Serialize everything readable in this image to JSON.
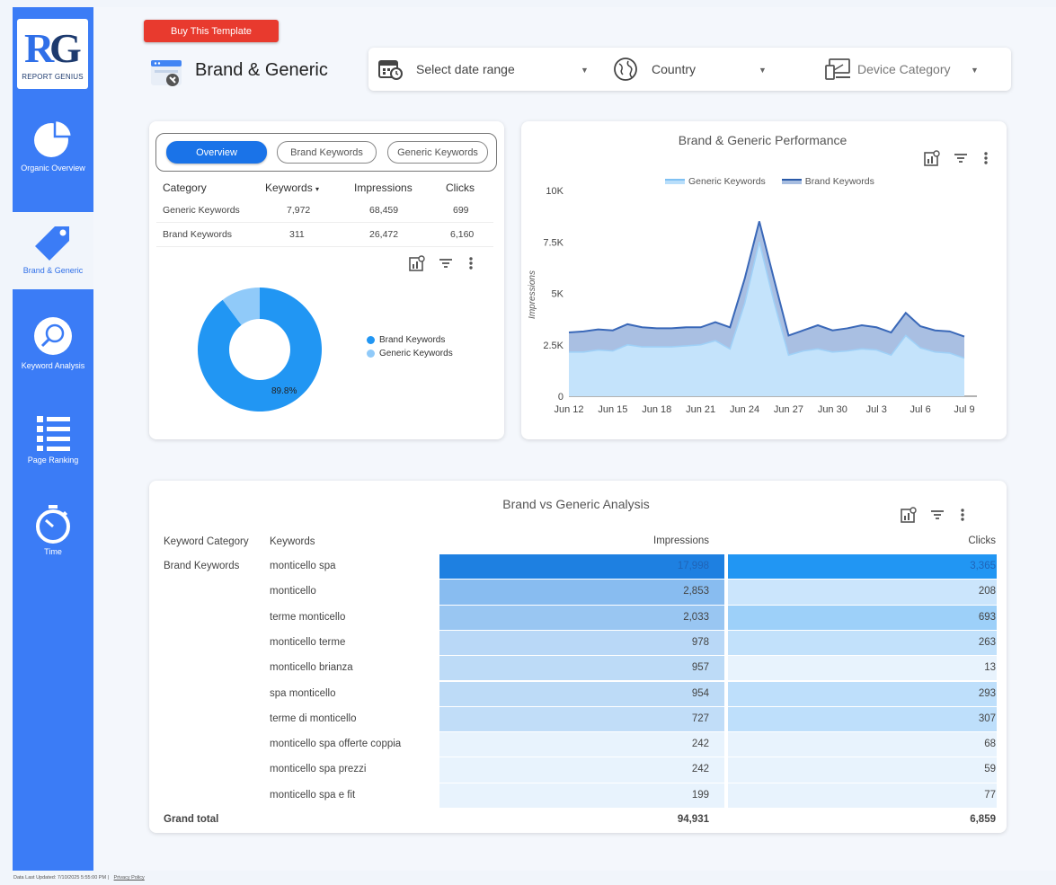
{
  "sidebar": {
    "logo_text": "REPORT GENIUS",
    "logo_letters": "RG",
    "items": [
      {
        "label": "Organic Overview",
        "icon": "pie-chart-icon"
      },
      {
        "label": "Brand & Generic",
        "icon": "tag-icon"
      },
      {
        "label": "Keyword Analysis",
        "icon": "magnify-icon"
      },
      {
        "label": "Page Ranking",
        "icon": "list-icon"
      },
      {
        "label": "Time",
        "icon": "stopwatch-icon"
      }
    ]
  },
  "header": {
    "buy_label": "Buy This Template",
    "title": "Brand & Generic"
  },
  "filters": {
    "date": "Select date range",
    "country": "Country",
    "device": "Device Category"
  },
  "tabs": [
    "Overview",
    "Brand Keywords",
    "Generic Keywords"
  ],
  "summary_table": {
    "headers": [
      "Category",
      "Keywords",
      "Impressions",
      "Clicks"
    ],
    "sort_indicator": "▾",
    "rows": [
      [
        "Generic Keywords",
        "7,972",
        "68,459",
        "699"
      ],
      [
        "Brand Keywords",
        "311",
        "26,472",
        "6,160"
      ]
    ]
  },
  "donut": {
    "legend": [
      "Brand Keywords",
      "Generic Keywords"
    ],
    "label": "89.8%",
    "values": [
      89.8,
      10.2
    ],
    "colors": [
      "#2196f3",
      "#90caf9"
    ]
  },
  "chart_data": {
    "type": "area",
    "title": "Brand & Generic Performance",
    "ylabel": "Impressions",
    "xlabel": "",
    "x_ticks": [
      "Jun 12",
      "Jun 15",
      "Jun 18",
      "Jun 21",
      "Jun 24",
      "Jun 27",
      "Jun 30",
      "Jul 3",
      "Jul 6",
      "Jul 9"
    ],
    "y_ticks": [
      "0",
      "2.5K",
      "5K",
      "7.5K",
      "10K"
    ],
    "ylim": [
      0,
      10000
    ],
    "legend_position": "top",
    "x": [
      "Jun 12",
      "Jun 13",
      "Jun 14",
      "Jun 15",
      "Jun 16",
      "Jun 17",
      "Jun 18",
      "Jun 19",
      "Jun 20",
      "Jun 21",
      "Jun 22",
      "Jun 23",
      "Jun 24",
      "Jun 25",
      "Jun 26",
      "Jun 27",
      "Jun 28",
      "Jun 29",
      "Jun 30",
      "Jul 1",
      "Jul 2",
      "Jul 3",
      "Jul 4",
      "Jul 5",
      "Jul 6",
      "Jul 7"
    ],
    "series": [
      {
        "name": "Generic Keywords",
        "color": "#9fd0f7",
        "values": [
          2150,
          2150,
          2250,
          2200,
          2500,
          2400,
          2400,
          2400,
          2450,
          2500,
          2700,
          2300,
          4500,
          7500,
          4600,
          2000,
          2200,
          2300,
          2150,
          2200,
          2300,
          2250,
          2000,
          2950,
          2350,
          2150,
          2100,
          1850
        ]
      },
      {
        "name": "Brand Keywords",
        "color": "#3a68b8",
        "values": [
          3100,
          3150,
          3250,
          3200,
          3500,
          3350,
          3300,
          3300,
          3350,
          3350,
          3600,
          3350,
          5700,
          8500,
          5700,
          2950,
          3200,
          3450,
          3200,
          3300,
          3450,
          3350,
          3100,
          4050,
          3400,
          3200,
          3150,
          2900
        ]
      }
    ]
  },
  "analysis": {
    "title": "Brand vs Generic Analysis",
    "headers": [
      "Keyword Category",
      "Keywords",
      "Impressions",
      "Clicks"
    ],
    "category": "Brand Keywords",
    "rows": [
      {
        "keyword": "monticello spa",
        "impressions": "17,998",
        "clicks": "3,365",
        "imp_level": 1.0,
        "clk_level": 1.0
      },
      {
        "keyword": "monticello",
        "impressions": "2,853",
        "clicks": "208",
        "imp_level": 0.26,
        "clk_level": 0.03
      },
      {
        "keyword": "terme monticello",
        "impressions": "2,033",
        "clicks": "693",
        "imp_level": 0.18,
        "clk_level": 0.17
      },
      {
        "keyword": "monticello terme",
        "impressions": "978",
        "clicks": "263",
        "imp_level": 0.07,
        "clk_level": 0.05
      },
      {
        "keyword": "monticello brianza",
        "impressions": "957",
        "clicks": "13",
        "imp_level": 0.06,
        "clk_level": 0.0
      },
      {
        "keyword": "spa monticello",
        "impressions": "954",
        "clicks": "293",
        "imp_level": 0.06,
        "clk_level": 0.06
      },
      {
        "keyword": "terme di monticello",
        "impressions": "727",
        "clicks": "307",
        "imp_level": 0.05,
        "clk_level": 0.06
      },
      {
        "keyword": "monticello spa offerte coppia",
        "impressions": "242",
        "clicks": "68",
        "imp_level": 0.01,
        "clk_level": 0.01
      },
      {
        "keyword": "monticello spa prezzi",
        "impressions": "242",
        "clicks": "59",
        "imp_level": 0.01,
        "clk_level": 0.01
      },
      {
        "keyword": "monticello spa e fit",
        "impressions": "199",
        "clicks": "77",
        "imp_level": 0.0,
        "clk_level": 0.01
      }
    ],
    "total_label": "Grand total",
    "total_impressions": "94,931",
    "total_clicks": "6,859"
  },
  "footer": {
    "updated": "Data Last Updated: 7/10/2025 5:55:00 PM",
    "privacy": "Privacy Policy"
  }
}
